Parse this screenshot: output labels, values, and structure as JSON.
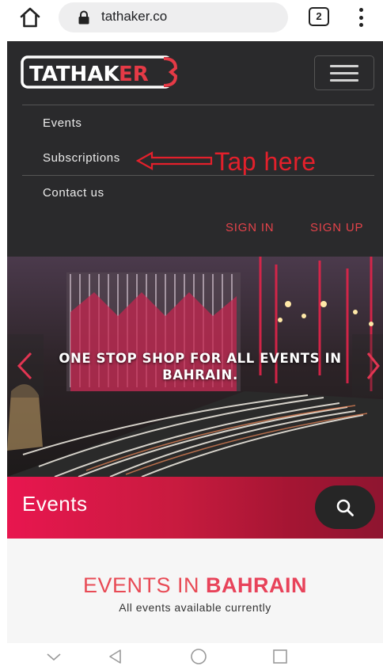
{
  "browser": {
    "url": "tathaker.co",
    "tab_count": "2",
    "icons": {
      "home": "home-icon",
      "lock": "lock-icon",
      "menu": "more-vert-icon"
    }
  },
  "site": {
    "logo_text_a": "TATHAK",
    "logo_text_b": "ER",
    "nav": {
      "events": "Events",
      "subscriptions": "Subscriptions",
      "contact": "Contact us"
    },
    "annotation": "Tap here",
    "sign_in": "SIGN IN",
    "sign_up": "SIGN UP",
    "colors": {
      "header_bg": "#2a2a2c",
      "accent": "#e4434a"
    }
  },
  "hero": {
    "heading": "ONE STOP SHOP FOR ALL EVENTS IN BAHRAIN."
  },
  "events_banner": {
    "title": "Events",
    "search_icon": "search-icon"
  },
  "events_section": {
    "heading_prefix": "EVENTS IN ",
    "heading_bold": "BAHRAIN",
    "subtitle": "All events available currently"
  },
  "android_nav": {
    "icons": [
      "chevron-down-icon",
      "back-icon",
      "home-circle-icon",
      "recents-icon"
    ]
  }
}
